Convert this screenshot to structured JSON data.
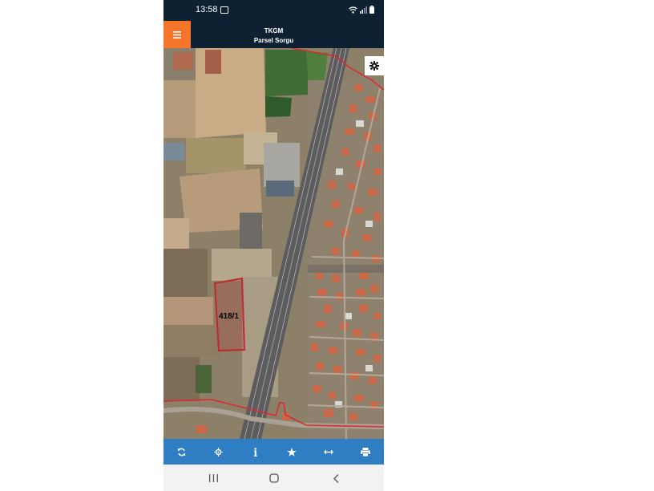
{
  "status_bar": {
    "time": "13:58",
    "icons": [
      "image-notification-icon",
      "wifi-icon",
      "signal-icon",
      "battery-icon"
    ]
  },
  "app_bar": {
    "title": "TKGM",
    "subtitle": "Parsel Sorgu",
    "menu_icon": "hamburger-menu-icon",
    "accent_color": "#f5762a",
    "background_color": "#0d2133"
  },
  "map": {
    "parcel_label": "418/1",
    "parcel_border_color": "#c1272d",
    "boundary_line_color": "#e0262e",
    "settings_icon": "gear-icon"
  },
  "toolbar": {
    "background_color": "#2f7dc2",
    "buttons": [
      "refresh-icon",
      "locate-icon",
      "info-icon",
      "favorite-star-icon",
      "measure-icon",
      "print-icon"
    ]
  },
  "nav_bar": {
    "buttons": [
      "recent-apps-icon",
      "home-icon",
      "back-icon"
    ]
  }
}
